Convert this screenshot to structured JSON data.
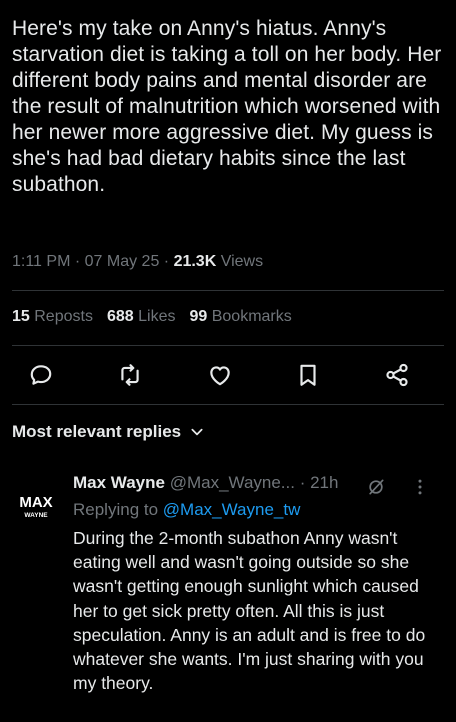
{
  "tweet": {
    "text": "Here's my take on Anny's hiatus. Anny's starvation diet is taking a toll on her body. Her different body pains and mental disorder are the result of malnutrition which worsened with her newer more aggressive diet. My guess is she's had bad dietary habits since the last subathon.",
    "time": "1:11 PM",
    "date": "07 May 25",
    "views_count": "21.3K",
    "views_label": "Views"
  },
  "stats": {
    "reposts_count": "15",
    "reposts_label": "Reposts",
    "likes_count": "688",
    "likes_label": "Likes",
    "bookmarks_count": "99",
    "bookmarks_label": "Bookmarks"
  },
  "actions": [
    "reply-icon",
    "repost-icon",
    "like-icon",
    "bookmark-icon",
    "share-icon"
  ],
  "replies_sort": {
    "label": "Most relevant replies"
  },
  "reply": {
    "name": "Max Wayne",
    "handle": "@Max_Wayne...",
    "time": "21h",
    "replying_prefix": "Replying to",
    "replying_handle": "@Max_Wayne_tw",
    "avatar_text": "MAX",
    "avatar_subtext": "WAYNE",
    "text": "During the 2-month subathon Anny wasn't eating well and wasn't going outside so she wasn't getting enough sunlight which caused her to get sick pretty often. All this is just speculation. Anny is an adult and is free to do whatever she wants. I'm just sharing with you my theory."
  },
  "colors": {
    "background": "#000000",
    "text": "#e7e9ea",
    "muted": "#71767b",
    "link": "#1d9bf0",
    "divider": "#2f3336"
  }
}
